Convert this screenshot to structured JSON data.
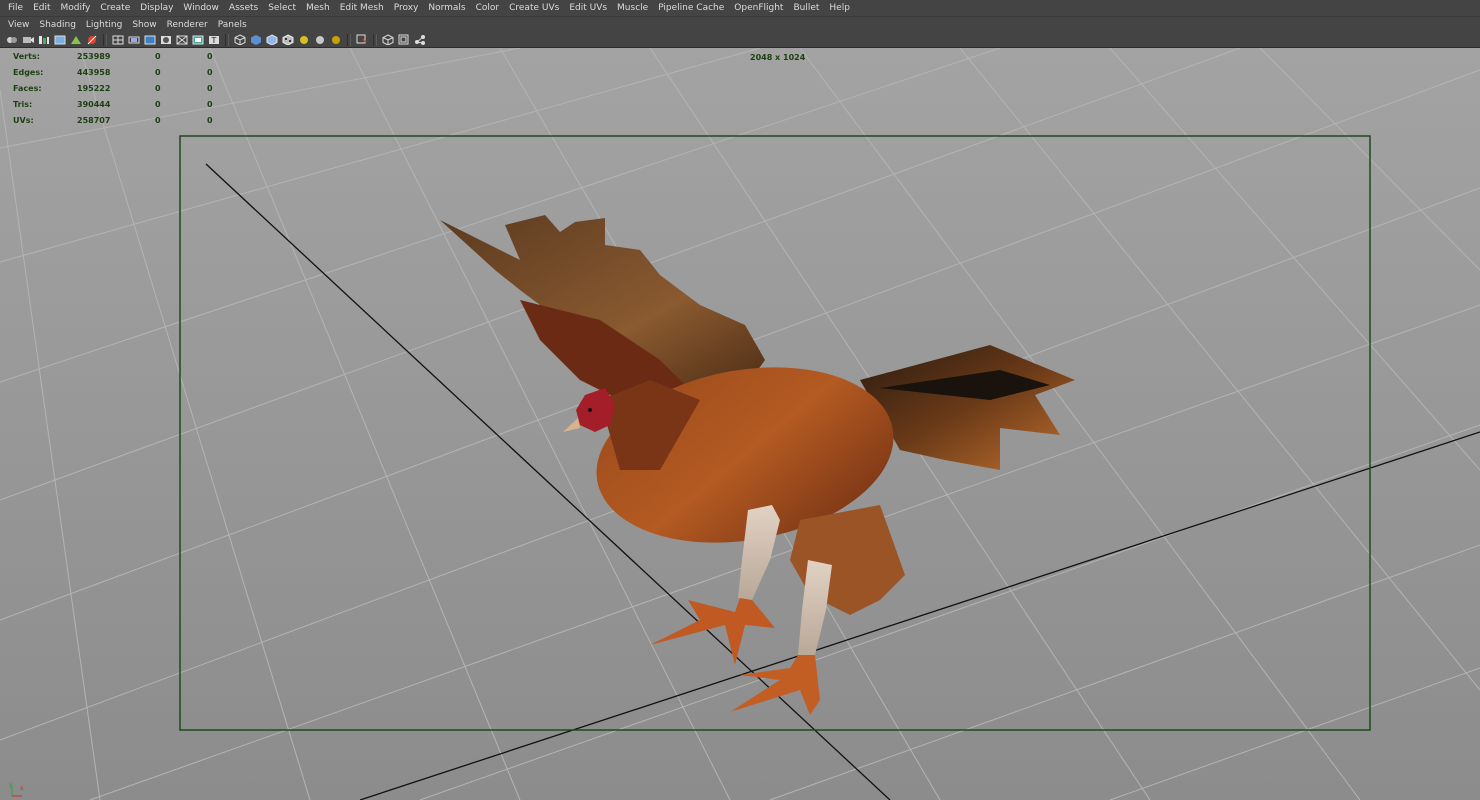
{
  "menubar": {
    "items": [
      "File",
      "Edit",
      "Modify",
      "Create",
      "Display",
      "Window",
      "Assets",
      "Select",
      "Mesh",
      "Edit Mesh",
      "Proxy",
      "Normals",
      "Color",
      "Create UVs",
      "Edit UVs",
      "Muscle",
      "Pipeline Cache",
      "OpenFlight",
      "Bullet",
      "Help"
    ]
  },
  "panel_menu": {
    "items": [
      "View",
      "Shading",
      "Lighting",
      "Show",
      "Renderer",
      "Panels"
    ]
  },
  "toolbar": {
    "icons": [
      "camera-select-icon",
      "camera-attributes-icon",
      "bookmark-icon",
      "image-plane-icon",
      "2d-pan-zoom-icon",
      "grease-pencil-icon",
      "grid-icon",
      "film-gate-icon",
      "resolution-gate-icon",
      "gate-mask-icon",
      "field-chart-icon",
      "safe-action-icon",
      "safe-title-icon",
      "wireframe-icon",
      "smooth-shade-icon",
      "default-material-icon",
      "textured-icon",
      "use-all-lights-icon",
      "shadows-icon",
      "screen-space-ao-icon",
      "isolate-select-icon",
      "xray-icon",
      "xray-joints-icon",
      "xray-components-icon"
    ]
  },
  "hud": {
    "rows": [
      {
        "label": "Verts:",
        "v1": "253989",
        "v2": "0",
        "v3": "0"
      },
      {
        "label": "Edges:",
        "v1": "443958",
        "v2": "0",
        "v3": "0"
      },
      {
        "label": "Faces:",
        "v1": "195222",
        "v2": "0",
        "v3": "0"
      },
      {
        "label": "Tris:",
        "v1": "390444",
        "v2": "0",
        "v3": "0"
      },
      {
        "label": "UVs:",
        "v1": "258707",
        "v2": "0",
        "v3": "0"
      }
    ],
    "resolution": "2048 x 1024"
  },
  "colors": {
    "menu_bg": "#444444",
    "viewport_bg": "#9b9b9b",
    "hud_text": "#1e3f12",
    "resolution_gate": "#1f4a1f",
    "grid_line": "#b4b4b4",
    "axis_line": "#111111"
  },
  "axis": {
    "x_label": "x",
    "y_label": "y"
  }
}
